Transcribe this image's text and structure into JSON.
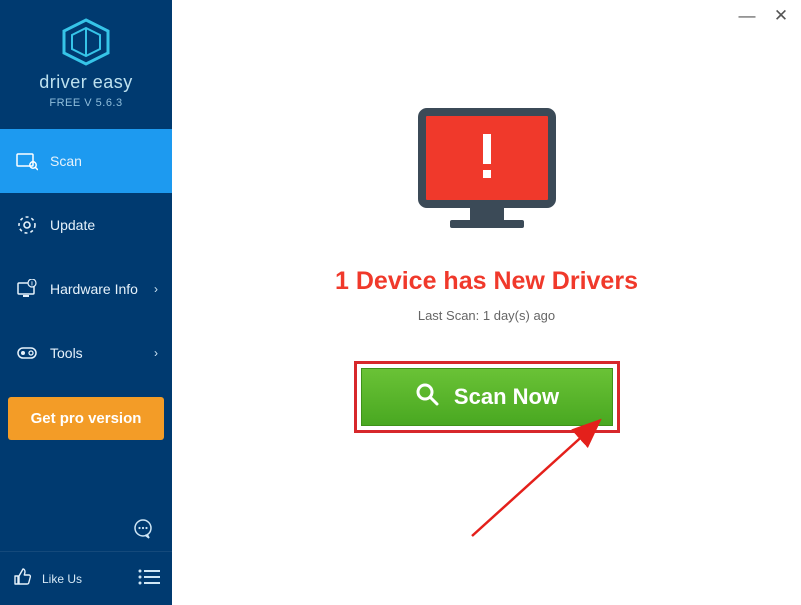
{
  "brand": "driver easy",
  "version": "FREE V 5.6.3",
  "sidebar": {
    "items": [
      {
        "label": "Scan",
        "active": true,
        "icon": "scan-icon",
        "chevron": false
      },
      {
        "label": "Update",
        "active": false,
        "icon": "update-icon",
        "chevron": false
      },
      {
        "label": "Hardware Info",
        "active": false,
        "icon": "hardware-info-icon",
        "chevron": true
      },
      {
        "label": "Tools",
        "active": false,
        "icon": "tools-icon",
        "chevron": true
      }
    ],
    "pro_button": "Get pro version",
    "like_label": "Like Us"
  },
  "window": {
    "minimize": "—",
    "close": "✕"
  },
  "main": {
    "headline": "1 Device has New Drivers",
    "last_scan": "Last Scan: 1 day(s) ago",
    "scan_button": "Scan Now"
  },
  "colors": {
    "sidebar_bg": "#003a70",
    "active_bg": "#1d9af0",
    "pro_bg": "#f39c27",
    "alert_red": "#f0392b",
    "scan_green": "#55b528",
    "highlight_border": "#d7282b"
  }
}
